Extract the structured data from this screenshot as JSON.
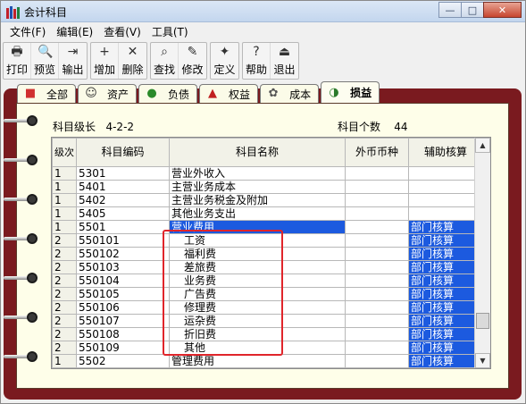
{
  "window": {
    "title": "会计科目",
    "buttons": {
      "minimize": "—",
      "maximize": "□",
      "close": "✕"
    }
  },
  "menu": [
    "文件(F)",
    "编辑(E)",
    "查看(V)",
    "工具(T)"
  ],
  "toolbar": [
    [
      {
        "label": "打印",
        "icon": "printer-icon",
        "glyph": "🖶"
      },
      {
        "label": "预览",
        "icon": "preview-icon",
        "glyph": "🔍"
      },
      {
        "label": "输出",
        "icon": "export-icon",
        "glyph": "⇥"
      }
    ],
    [
      {
        "label": "增加",
        "icon": "add-icon",
        "glyph": "+"
      },
      {
        "label": "删除",
        "icon": "delete-icon",
        "glyph": "✕"
      }
    ],
    [
      {
        "label": "查找",
        "icon": "find-icon",
        "glyph": "⌕"
      },
      {
        "label": "修改",
        "icon": "edit-icon",
        "glyph": "✎"
      }
    ],
    [
      {
        "label": "定义",
        "icon": "define-icon",
        "glyph": "✦"
      }
    ],
    [
      {
        "label": "帮助",
        "icon": "help-icon",
        "glyph": "?"
      },
      {
        "label": "退出",
        "icon": "exit-icon",
        "glyph": "⏏"
      }
    ]
  ],
  "tabs": [
    {
      "label": "全部",
      "icon": "all-icon",
      "glyph": "■",
      "color": "#d03030",
      "active": false
    },
    {
      "label": "资产",
      "icon": "asset-icon",
      "glyph": "☺",
      "color": "#333333",
      "active": false
    },
    {
      "label": "负债",
      "icon": "liability-icon",
      "glyph": "●",
      "color": "#2a8a2a",
      "active": false
    },
    {
      "label": "权益",
      "icon": "equity-icon",
      "glyph": "▲",
      "color": "#c02020",
      "active": false
    },
    {
      "label": "成本",
      "icon": "cost-icon",
      "glyph": "✿",
      "color": "#555555",
      "active": false
    },
    {
      "label": "损益",
      "icon": "profit-loss-icon",
      "glyph": "◑",
      "color": "#2a7a2a",
      "active": true
    }
  ],
  "info": {
    "level_label": "科目级长",
    "level_value": "4-2-2",
    "count_label": "科目个数",
    "count_value": "44"
  },
  "table": {
    "headers": {
      "level": "级次",
      "code": "科目编码",
      "name": "科目名称",
      "currency": "外币币种",
      "aux": "辅助核算"
    },
    "rows": [
      {
        "level": "1",
        "code": "5301",
        "name": "营业外收入",
        "currency": "",
        "aux": ""
      },
      {
        "level": "1",
        "code": "5401",
        "name": "主营业务成本",
        "currency": "",
        "aux": ""
      },
      {
        "level": "1",
        "code": "5402",
        "name": "主营业务税金及附加",
        "currency": "",
        "aux": ""
      },
      {
        "level": "1",
        "code": "5405",
        "name": "其他业务支出",
        "currency": "",
        "aux": ""
      },
      {
        "level": "1",
        "code": "5501",
        "name": "营业费用",
        "currency": "",
        "aux": "部门核算",
        "selected": true
      },
      {
        "level": "2",
        "code": "550101",
        "name": "工资",
        "currency": "",
        "aux": "部门核算",
        "indent": true
      },
      {
        "level": "2",
        "code": "550102",
        "name": "福利费",
        "currency": "",
        "aux": "部门核算",
        "indent": true
      },
      {
        "level": "2",
        "code": "550103",
        "name": "差旅费",
        "currency": "",
        "aux": "部门核算",
        "indent": true
      },
      {
        "level": "2",
        "code": "550104",
        "name": "业务费",
        "currency": "",
        "aux": "部门核算",
        "indent": true
      },
      {
        "level": "2",
        "code": "550105",
        "name": "广告费",
        "currency": "",
        "aux": "部门核算",
        "indent": true
      },
      {
        "level": "2",
        "code": "550106",
        "name": "修理费",
        "currency": "",
        "aux": "部门核算",
        "indent": true
      },
      {
        "level": "2",
        "code": "550107",
        "name": "运杂费",
        "currency": "",
        "aux": "部门核算",
        "indent": true
      },
      {
        "level": "2",
        "code": "550108",
        "name": "折旧费",
        "currency": "",
        "aux": "部门核算",
        "indent": true
      },
      {
        "level": "2",
        "code": "550109",
        "name": "其他",
        "currency": "",
        "aux": "部门核算",
        "indent": true
      },
      {
        "level": "1",
        "code": "5502",
        "name": "管理费用",
        "currency": "",
        "aux": "部门核算"
      }
    ]
  },
  "colors": {
    "notebook": "#7a1a1f",
    "selection": "#1c5adf",
    "highlight": "#e0252b",
    "page": "#fefee9"
  }
}
